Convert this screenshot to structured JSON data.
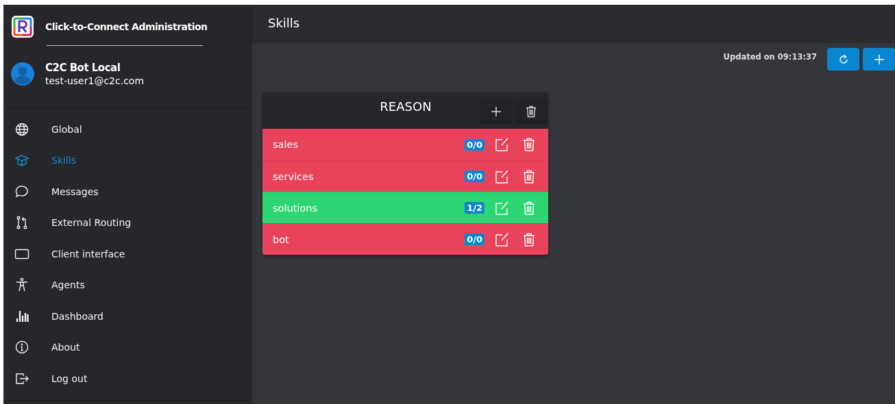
{
  "app": {
    "title": "Click-to-Connect Administration"
  },
  "user": {
    "name": "C2C Bot Local",
    "email": "test-user1@c2c.com"
  },
  "sidebar": {
    "items": [
      {
        "label": "Global",
        "selected": false
      },
      {
        "label": "Skills",
        "selected": true
      },
      {
        "label": "Messages",
        "selected": false
      },
      {
        "label": "External Routing",
        "selected": false
      },
      {
        "label": "Client interface",
        "selected": false
      },
      {
        "label": "Agents",
        "selected": false
      },
      {
        "label": "Dashboard",
        "selected": false
      },
      {
        "label": "About",
        "selected": false
      },
      {
        "label": "Log out",
        "selected": false
      }
    ]
  },
  "page": {
    "title": "Skills",
    "updated": "Updated on 09:13:37"
  },
  "group": {
    "title": "REASON",
    "rows": [
      {
        "name": "sales",
        "count": "0/0",
        "active": false
      },
      {
        "name": "services",
        "count": "0/0",
        "active": false
      },
      {
        "name": "solutions",
        "count": "1/2",
        "active": true
      },
      {
        "name": "bot",
        "count": "0/0",
        "active": false
      }
    ]
  }
}
